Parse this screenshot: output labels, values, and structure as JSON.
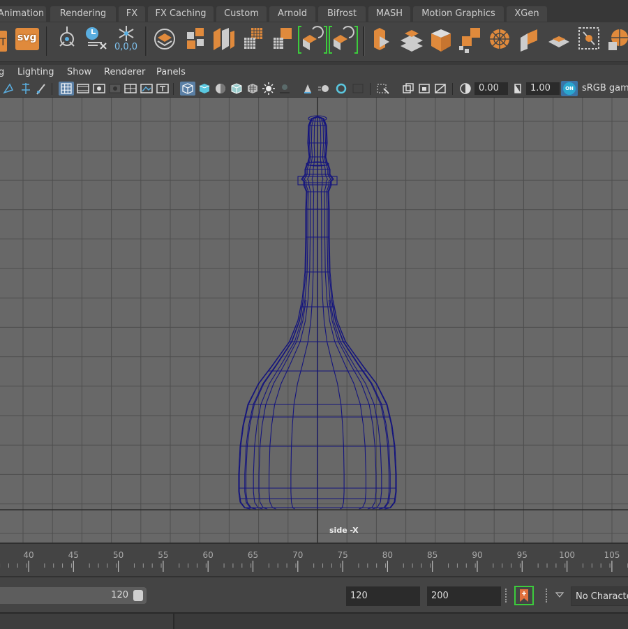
{
  "shelf_tabs": [
    "Animation",
    "Rendering",
    "FX",
    "FX Caching",
    "Custom",
    "Arnold",
    "Bifrost",
    "MASH",
    "Motion Graphics",
    "XGen"
  ],
  "shelf": {
    "svg_label": "svg",
    "lights_label": "0,0,0"
  },
  "panel_menu": [
    "g",
    "Lighting",
    "Show",
    "Renderer",
    "Panels"
  ],
  "panel_toolbar": {
    "exposure_value": "0.00",
    "gamma_value": "1.00",
    "color_management_badge": "ON",
    "color_space": "sRGB gamma"
  },
  "viewport": {
    "camera_label": "side -X",
    "wireframe_color": "#15157d"
  },
  "timeline": {
    "ticks": [
      "40",
      "45",
      "50",
      "55",
      "60",
      "65",
      "70",
      "75",
      "80",
      "85",
      "90",
      "95",
      "100",
      "105"
    ]
  },
  "range": {
    "slider_value": "120",
    "end_time": "120",
    "anim_end_time": "200",
    "character_set": "No Character Set"
  },
  "colors": {
    "accent_orange": "#e08a3c",
    "accent_green": "#3ccc3c",
    "accent_blue": "#5aaee0"
  }
}
